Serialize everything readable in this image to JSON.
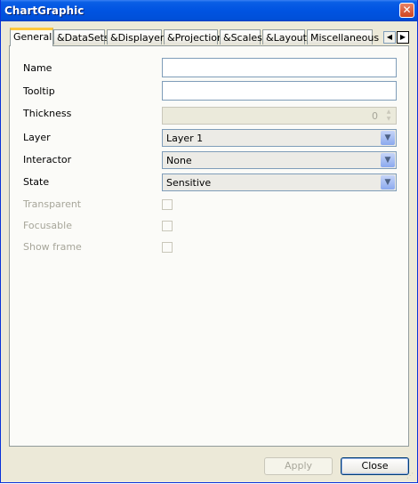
{
  "window": {
    "title": "ChartGraphic",
    "close_glyph": "✕"
  },
  "tabs": [
    {
      "label": "General",
      "active": true
    },
    {
      "label": "&DataSets"
    },
    {
      "label": "&Displayers"
    },
    {
      "label": "&Projection"
    },
    {
      "label": "&Scales"
    },
    {
      "label": "&Layout"
    },
    {
      "label": "Miscellaneous"
    }
  ],
  "tab_scroll": {
    "left_icon": "◀",
    "right_icon": "▶"
  },
  "form": {
    "name": {
      "label": "Name",
      "value": ""
    },
    "tooltip": {
      "label": "Tooltip",
      "value": ""
    },
    "thickness": {
      "label": "Thickness",
      "value": "0"
    },
    "layer": {
      "label": "Layer",
      "value": "Layer 1"
    },
    "interactor": {
      "label": "Interactor",
      "value": "None"
    },
    "state": {
      "label": "State",
      "value": "Sensitive"
    },
    "transparent": {
      "label": "Transparent",
      "checked": false
    },
    "focusable": {
      "label": "Focusable",
      "checked": false
    },
    "show_frame": {
      "label": "Show frame",
      "checked": false
    }
  },
  "buttons": {
    "apply": "Apply",
    "close": "Close"
  },
  "colors": {
    "titlebar": "#0053e1",
    "active_tab_accent": "#ffc83c",
    "panel": "#fbfbf8",
    "window": "#ece9d8"
  }
}
